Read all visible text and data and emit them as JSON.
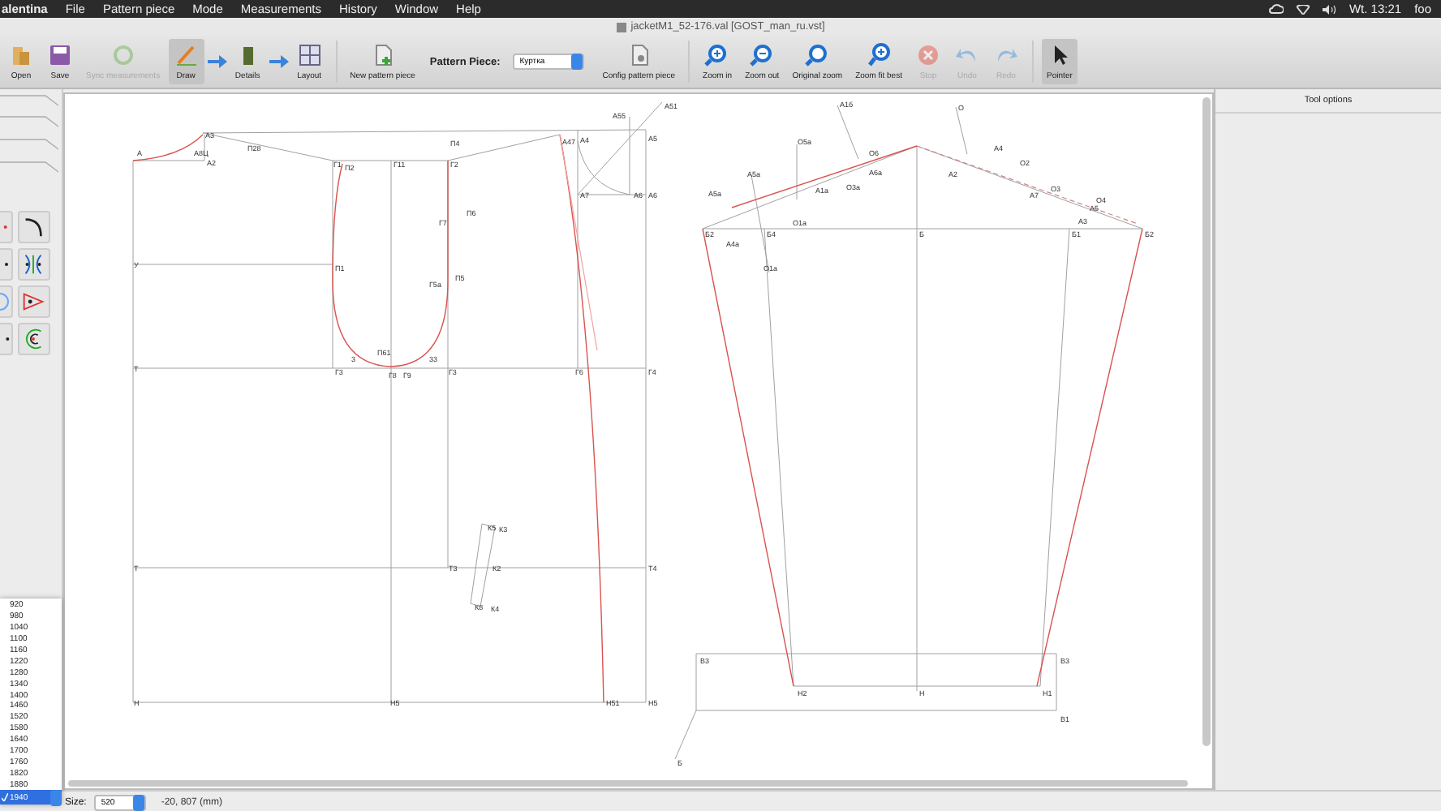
{
  "menu_bar": {
    "app": "alentina",
    "items": [
      "File",
      "Pattern piece",
      "Mode",
      "Measurements",
      "History",
      "Window",
      "Help"
    ],
    "clock": "Wt. 13:21",
    "user": "foo"
  },
  "window": {
    "title": "jacketM1_52-176.val [GOST_man_ru.vst]"
  },
  "toolbar": {
    "items": [
      {
        "kind": "button",
        "label": "Open",
        "disabled": false,
        "selected": false
      },
      {
        "kind": "button",
        "label": "Save",
        "disabled": false,
        "selected": false
      },
      {
        "kind": "button",
        "label": "Sync measurements",
        "disabled": true,
        "selected": false
      },
      {
        "kind": "button",
        "label": "Draw",
        "disabled": false,
        "selected": true
      },
      {
        "kind": "arrow"
      },
      {
        "kind": "button",
        "label": "Details",
        "disabled": false,
        "selected": false
      },
      {
        "kind": "arrow"
      },
      {
        "kind": "button",
        "label": "Layout",
        "disabled": false,
        "selected": false
      },
      {
        "kind": "button",
        "label": "New pattern piece",
        "disabled": false,
        "selected": false
      },
      {
        "kind": "select",
        "label": "Pattern Piece:",
        "value": "Куртка"
      },
      {
        "kind": "button",
        "label": "Config pattern piece",
        "disabled": false,
        "selected": false
      },
      {
        "kind": "button",
        "label": "Zoom in",
        "disabled": false,
        "selected": false
      },
      {
        "kind": "button",
        "label": "Zoom out",
        "disabled": false,
        "selected": false
      },
      {
        "kind": "button",
        "label": "Original zoom",
        "disabled": false,
        "selected": false
      },
      {
        "kind": "button",
        "label": "Zoom fit best",
        "disabled": false,
        "selected": false
      },
      {
        "kind": "button",
        "label": "Stop",
        "disabled": true,
        "selected": false
      },
      {
        "kind": "button",
        "label": "Undo",
        "disabled": true,
        "selected": false
      },
      {
        "kind": "button",
        "label": "Redo",
        "disabled": true,
        "selected": false
      },
      {
        "kind": "button",
        "label": "Pointer",
        "disabled": false,
        "selected": true
      }
    ]
  },
  "canvas": {
    "pieces": [
      {
        "labels": [
          "A",
          "A3",
          "A8Ц",
          "A2",
          "П28",
          "Г1",
          "П2",
          "Г11",
          "П4",
          "Г2",
          "П6",
          "Г7",
          "У",
          "П1",
          "П5",
          "Г5а",
          "3",
          "П61",
          "33",
          "Т",
          "Г3",
          "Г8",
          "Г9",
          "Г3",
          "Г6",
          "Г4",
          "A47",
          "A4",
          "A5",
          "A55",
          "A51",
          "A7",
          "A6",
          "A6",
          "К5",
          "К3",
          "Т",
          "Т3",
          "К2",
          "К8",
          "К4",
          "Т4",
          "Н",
          "Н5",
          "Н51",
          "Н5"
        ]
      },
      {
        "labels": [
          "A1б",
          "O",
          "O5а",
          "A5а",
          "A5а",
          "A4",
          "O6",
          "A6а",
          "O2",
          "A2",
          "A1а",
          "O3а",
          "O3",
          "A7",
          "A5",
          "O4",
          "A3",
          "O1а",
          "Б2",
          "Б4",
          "Б",
          "Б1",
          "Б2",
          "A4а",
          "O1а",
          "В3",
          "В3",
          "Н2",
          "Н",
          "Н1",
          "В1",
          "Б"
        ]
      }
    ]
  },
  "dock": {
    "title": "Tool options"
  },
  "height_dropdown": {
    "options": [
      {
        "label": "920",
        "selected": false
      },
      {
        "label": "980",
        "selected": false
      },
      {
        "label": "1040",
        "selected": false
      },
      {
        "label": "1100",
        "selected": false
      },
      {
        "label": "1160",
        "selected": false
      },
      {
        "label": "1220",
        "selected": false
      },
      {
        "label": "1280",
        "selected": false
      },
      {
        "label": "1340",
        "selected": false
      },
      {
        "label": "1400",
        "selected": false
      },
      {
        "label": "1460",
        "selected": false
      },
      {
        "label": "1520",
        "selected": false
      },
      {
        "label": "1580",
        "selected": false
      },
      {
        "label": "1640",
        "selected": false
      },
      {
        "label": "1700",
        "selected": false
      },
      {
        "label": "1760",
        "selected": false
      },
      {
        "label": "1820",
        "selected": false
      },
      {
        "label": "1880",
        "selected": false
      },
      {
        "label": "1940",
        "selected": true
      }
    ]
  },
  "status_bar": {
    "size_label": "Size:",
    "size_value": "520",
    "coordinates": "-20, 807 (mm)"
  }
}
